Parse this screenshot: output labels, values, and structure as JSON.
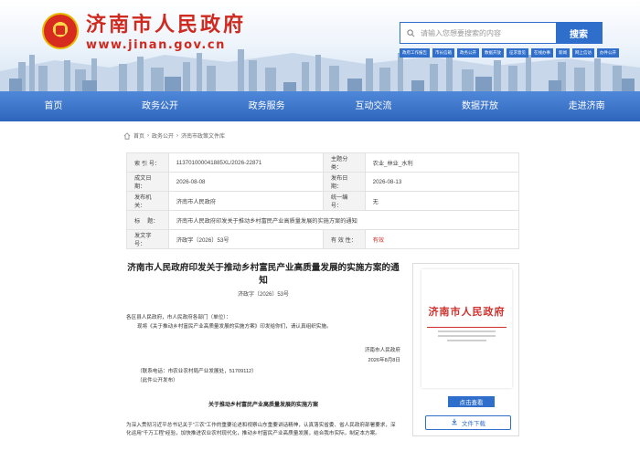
{
  "header": {
    "site_title": "济南市人民政府",
    "site_url": "www.jinan.gov.cn",
    "search_placeholder": "请输入您想要搜索的内容",
    "search_button": "搜索",
    "quick_links": [
      "政府工作报告",
      "市长信箱",
      "政务公开",
      "数据开放",
      "征求意见",
      "在线办事",
      "新闻",
      "网上信访",
      "办件公开"
    ]
  },
  "nav": {
    "items": [
      "首页",
      "政务公开",
      "政务服务",
      "互动交流",
      "数据开放",
      "走进济南"
    ]
  },
  "breadcrumb": {
    "items": [
      "首页",
      "政务公开",
      "济南市政策文件库"
    ]
  },
  "meta": {
    "index_label": "索 引 号：",
    "index_value": "113701000041885XL/2026-22871",
    "topic_label": "主题分类：",
    "topic_value": "农业_林业_水利",
    "created_label": "成文日期：",
    "created_value": "2026-08-08",
    "published_label": "发布日期：",
    "published_value": "2026-08-13",
    "issuer_label": "发布机关：",
    "issuer_value": "济南市人民政府",
    "unified_label": "统一编号：",
    "unified_value": "无",
    "title_label": "标　 题：",
    "title_value": "济南市人民政府印发关于推动乡村富民产业高质量发展的实施方案的通知",
    "docno_label": "发文字号：",
    "docno_value": "济政字〔2026〕53号",
    "validity_label": "有 效 性：",
    "validity_value": "有效"
  },
  "document": {
    "title": "济南市人民政府印发关于推动乡村富民产业高质量发展的实施方案的通知",
    "doc_no": "济政字〔2026〕53号",
    "addressee": "各区县人民政府，市人民政府各部门（单位）：",
    "para1": "现将《关于推动乡村富民产业高质量发展的实施方案》印发给你们，请认真组织实施。",
    "signer": "济南市人民政府",
    "date": "2026年8月8日",
    "contact": "（联系电话：市农业农村局产业发展处，51709112）",
    "public_note": "（此件公开发布）",
    "sub_title": "关于推动乡村富民产业高质量发展的实施方案",
    "para2": "为深入贯彻习近平总书记关于“三农”工作的重要论述和视察山东重要讲话精神，认真落实省委、省人民政府部署要求，深化运用“千万工程”经验，加快推进农业农村现代化，推动乡村富民产业高质量发展，结合我市实际，制定本方案。"
  },
  "card": {
    "doc_title": "济南市人民政府",
    "view_button": "点击查看",
    "download_button": "文件下载"
  },
  "colors": {
    "brand_red": "#cf2a1f",
    "nav_blue": "#2f66bd",
    "accent_blue": "#2f6fcb"
  }
}
